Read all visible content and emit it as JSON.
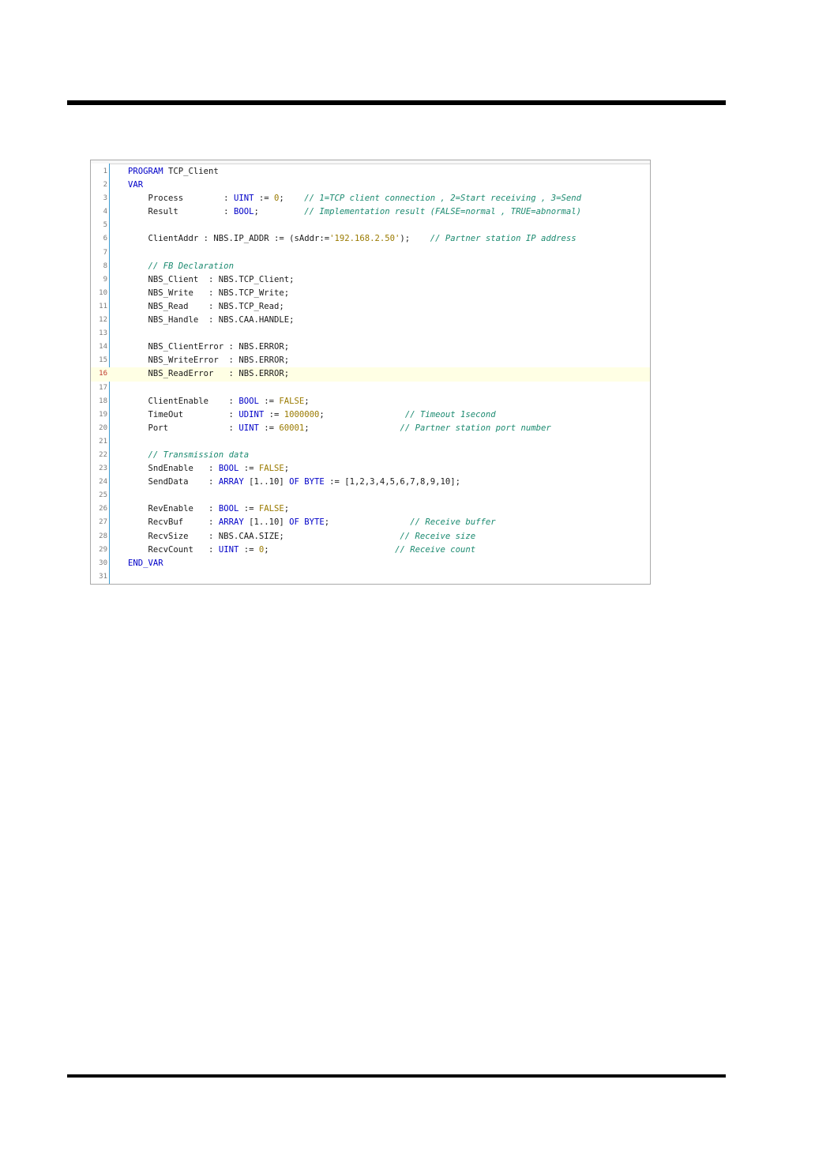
{
  "document": {
    "editor": {
      "current_line": 16,
      "lines": [
        {
          "n": "1",
          "segs": [
            {
              "t": "PROGRAM",
              "c": "kw"
            },
            {
              "t": " TCP_Client",
              "c": "id"
            }
          ]
        },
        {
          "n": "2",
          "segs": [
            {
              "t": "VAR",
              "c": "kw"
            }
          ]
        },
        {
          "n": "3",
          "segs": [
            {
              "t": "    Process        : ",
              "c": "id"
            },
            {
              "t": "UINT",
              "c": "kw"
            },
            {
              "t": " := ",
              "c": "id"
            },
            {
              "t": "0",
              "c": "lit"
            },
            {
              "t": ";    ",
              "c": "id"
            },
            {
              "t": "// 1=TCP client connection , 2=Start receiving , 3=Send",
              "c": "cm"
            }
          ]
        },
        {
          "n": "4",
          "segs": [
            {
              "t": "    Result         : ",
              "c": "id"
            },
            {
              "t": "BOOL",
              "c": "kw"
            },
            {
              "t": ";         ",
              "c": "id"
            },
            {
              "t": "// Implementation result (FALSE=normal , TRUE=abnormal)",
              "c": "cm"
            }
          ]
        },
        {
          "n": "5",
          "segs": []
        },
        {
          "n": "6",
          "segs": [
            {
              "t": "    ClientAddr : NBS.IP_ADDR := (sAddr:=",
              "c": "id"
            },
            {
              "t": "'192.168.2.50'",
              "c": "lit"
            },
            {
              "t": ");    ",
              "c": "id"
            },
            {
              "t": "// Partner station IP address",
              "c": "cm"
            }
          ]
        },
        {
          "n": "7",
          "segs": []
        },
        {
          "n": "8",
          "segs": [
            {
              "t": "    ",
              "c": "id"
            },
            {
              "t": "// FB Declaration",
              "c": "cm"
            }
          ]
        },
        {
          "n": "9",
          "segs": [
            {
              "t": "    NBS_Client  : NBS.TCP_Client;",
              "c": "id"
            }
          ]
        },
        {
          "n": "10",
          "segs": [
            {
              "t": "    NBS_Write   : NBS.TCP_Write;",
              "c": "id"
            }
          ]
        },
        {
          "n": "11",
          "segs": [
            {
              "t": "    NBS_Read    : NBS.TCP_Read;",
              "c": "id"
            }
          ]
        },
        {
          "n": "12",
          "segs": [
            {
              "t": "    NBS_Handle  : NBS.CAA.HANDLE;",
              "c": "id"
            }
          ]
        },
        {
          "n": "13",
          "segs": []
        },
        {
          "n": "14",
          "segs": [
            {
              "t": "    NBS_ClientError : NBS.ERROR;",
              "c": "id"
            }
          ]
        },
        {
          "n": "15",
          "segs": [
            {
              "t": "    NBS_WriteError  : NBS.ERROR;",
              "c": "id"
            }
          ]
        },
        {
          "n": "16",
          "segs": [
            {
              "t": "    NBS_ReadError   : NBS.ERROR;",
              "c": "id"
            }
          ]
        },
        {
          "n": "17",
          "segs": []
        },
        {
          "n": "18",
          "segs": [
            {
              "t": "    ClientEnable    : ",
              "c": "id"
            },
            {
              "t": "BOOL",
              "c": "kw"
            },
            {
              "t": " := ",
              "c": "id"
            },
            {
              "t": "FALSE",
              "c": "lit"
            },
            {
              "t": ";",
              "c": "id"
            }
          ]
        },
        {
          "n": "19",
          "segs": [
            {
              "t": "    TimeOut         : ",
              "c": "id"
            },
            {
              "t": "UDINT",
              "c": "kw"
            },
            {
              "t": " := ",
              "c": "id"
            },
            {
              "t": "1000000",
              "c": "lit"
            },
            {
              "t": ";                ",
              "c": "id"
            },
            {
              "t": "// Timeout 1second",
              "c": "cm"
            }
          ]
        },
        {
          "n": "20",
          "segs": [
            {
              "t": "    Port            : ",
              "c": "id"
            },
            {
              "t": "UINT",
              "c": "kw"
            },
            {
              "t": " := ",
              "c": "id"
            },
            {
              "t": "60001",
              "c": "lit"
            },
            {
              "t": ";                  ",
              "c": "id"
            },
            {
              "t": "// Partner station port number",
              "c": "cm"
            }
          ]
        },
        {
          "n": "21",
          "segs": []
        },
        {
          "n": "22",
          "segs": [
            {
              "t": "    ",
              "c": "id"
            },
            {
              "t": "// Transmission data",
              "c": "cm"
            }
          ]
        },
        {
          "n": "23",
          "segs": [
            {
              "t": "    SndEnable   : ",
              "c": "id"
            },
            {
              "t": "BOOL",
              "c": "kw"
            },
            {
              "t": " := ",
              "c": "id"
            },
            {
              "t": "FALSE",
              "c": "lit"
            },
            {
              "t": ";",
              "c": "id"
            }
          ]
        },
        {
          "n": "24",
          "segs": [
            {
              "t": "    SendData    : ",
              "c": "id"
            },
            {
              "t": "ARRAY",
              "c": "kw"
            },
            {
              "t": " [1..10] ",
              "c": "id"
            },
            {
              "t": "OF BYTE",
              "c": "kw"
            },
            {
              "t": " := [1,2,3,4,5,6,7,8,9,10];",
              "c": "id"
            }
          ]
        },
        {
          "n": "25",
          "segs": []
        },
        {
          "n": "26",
          "segs": [
            {
              "t": "    RevEnable   : ",
              "c": "id"
            },
            {
              "t": "BOOL",
              "c": "kw"
            },
            {
              "t": " := ",
              "c": "id"
            },
            {
              "t": "FALSE",
              "c": "lit"
            },
            {
              "t": ";",
              "c": "id"
            }
          ]
        },
        {
          "n": "27",
          "segs": [
            {
              "t": "    RecvBuf     : ",
              "c": "id"
            },
            {
              "t": "ARRAY",
              "c": "kw"
            },
            {
              "t": " [1..10] ",
              "c": "id"
            },
            {
              "t": "OF BYTE",
              "c": "kw"
            },
            {
              "t": ";                ",
              "c": "id"
            },
            {
              "t": "// Receive buffer",
              "c": "cm"
            }
          ]
        },
        {
          "n": "28",
          "segs": [
            {
              "t": "    RecvSize    : NBS.CAA.SIZE;                       ",
              "c": "id"
            },
            {
              "t": "// Receive size",
              "c": "cm"
            }
          ]
        },
        {
          "n": "29",
          "segs": [
            {
              "t": "    RecvCount   : ",
              "c": "id"
            },
            {
              "t": "UINT",
              "c": "kw"
            },
            {
              "t": " := ",
              "c": "id"
            },
            {
              "t": "0",
              "c": "lit"
            },
            {
              "t": ";                         ",
              "c": "id"
            },
            {
              "t": "// Receive count",
              "c": "cm"
            }
          ]
        },
        {
          "n": "30",
          "segs": [
            {
              "t": "END_VAR",
              "c": "kw"
            }
          ]
        },
        {
          "n": "31",
          "segs": []
        }
      ]
    }
  }
}
